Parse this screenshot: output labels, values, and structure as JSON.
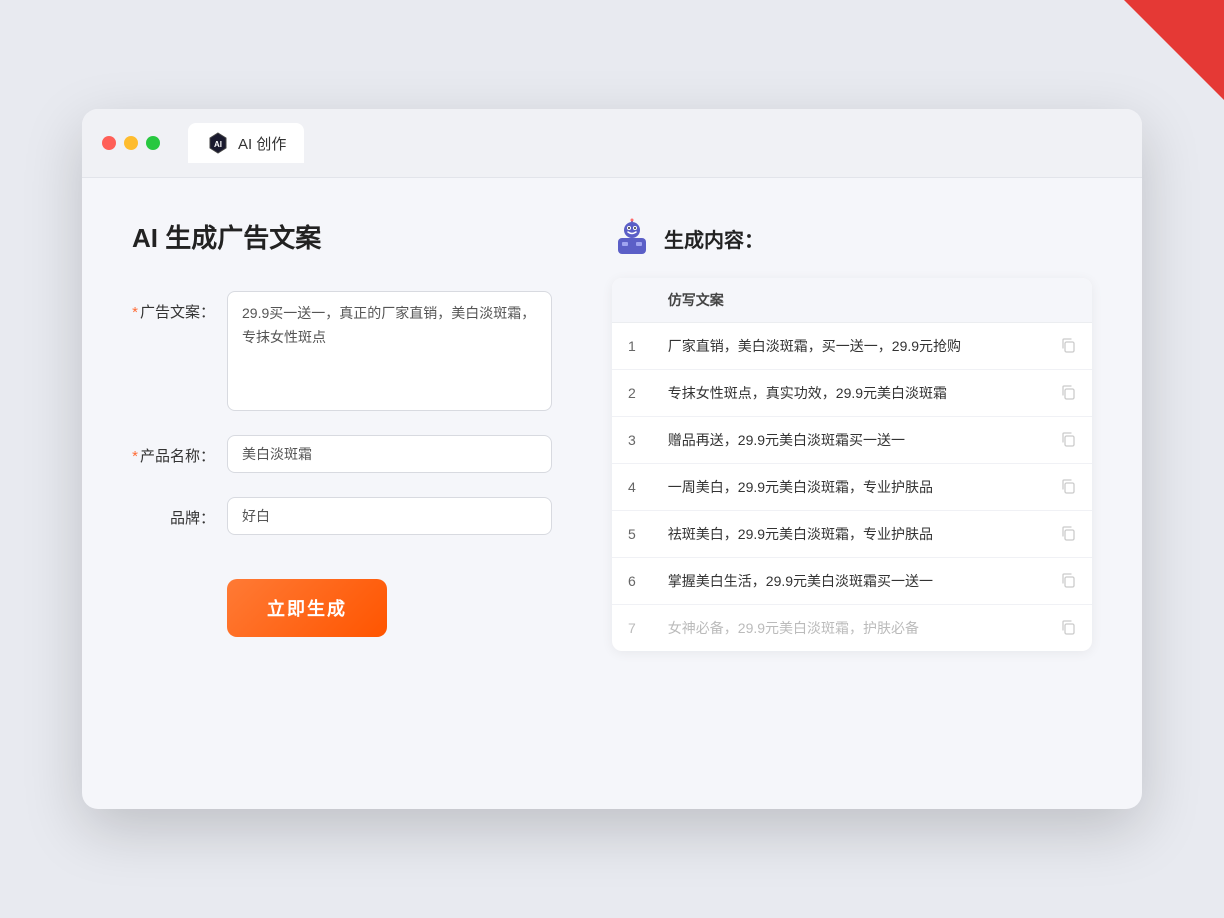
{
  "browser": {
    "tab_label": "AI 创作"
  },
  "page": {
    "title": "AI 生成广告文案",
    "result_header": "生成内容："
  },
  "form": {
    "ad_copy_label": "广告文案：",
    "ad_copy_required": "＊",
    "ad_copy_value": "29.9买一送一，真正的厂家直销，美白淡斑霜，专抹女性斑点",
    "product_name_label": "产品名称：",
    "product_name_required": "＊",
    "product_name_value": "美白淡斑霜",
    "brand_label": "品牌：",
    "brand_value": "好白",
    "generate_btn": "立即生成"
  },
  "results": {
    "column_label": "仿写文案",
    "items": [
      {
        "num": 1,
        "text": "厂家直销，美白淡斑霜，买一送一，29.9元抢购",
        "faded": false
      },
      {
        "num": 2,
        "text": "专抹女性斑点，真实功效，29.9元美白淡斑霜",
        "faded": false
      },
      {
        "num": 3,
        "text": "赠品再送，29.9元美白淡斑霜买一送一",
        "faded": false
      },
      {
        "num": 4,
        "text": "一周美白，29.9元美白淡斑霜，专业护肤品",
        "faded": false
      },
      {
        "num": 5,
        "text": "祛斑美白，29.9元美白淡斑霜，专业护肤品",
        "faded": false
      },
      {
        "num": 6,
        "text": "掌握美白生活，29.9元美白淡斑霜买一送一",
        "faded": false
      },
      {
        "num": 7,
        "text": "女神必备，29.9元美白淡斑霜，护肤必备",
        "faded": true
      }
    ]
  }
}
